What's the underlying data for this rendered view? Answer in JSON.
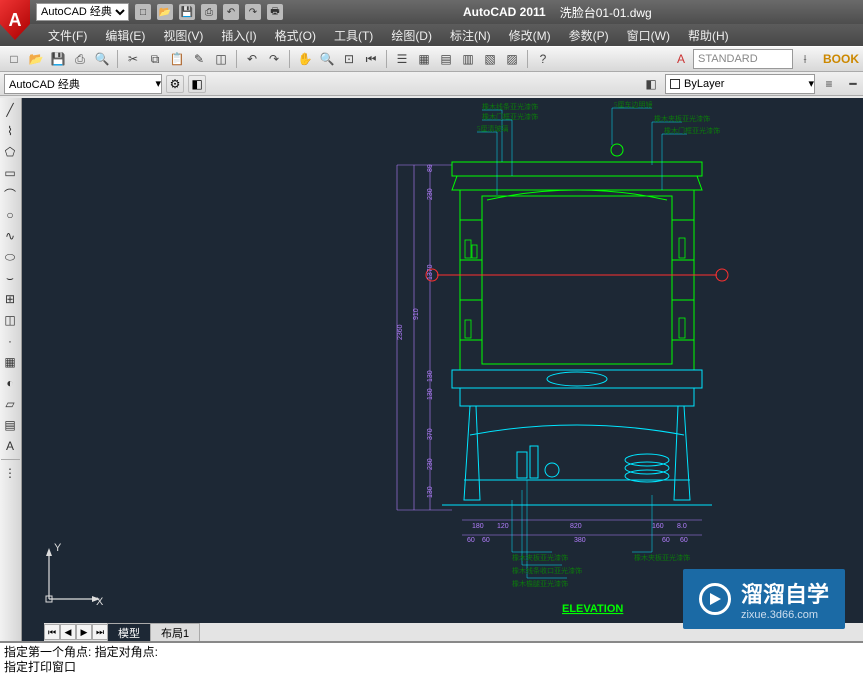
{
  "app": {
    "name": "AutoCAD 2011",
    "document": "洗脸台01-01.dwg",
    "workspace_combo": "AutoCAD 经典",
    "workspace_combo2": "AutoCAD 经典",
    "layer_combo": "ByLayer",
    "style_combo": "STANDARD",
    "book": "BOOK"
  },
  "menus": {
    "file": "文件(F)",
    "edit": "编辑(E)",
    "view": "视图(V)",
    "insert": "插入(I)",
    "format": "格式(O)",
    "tools": "工具(T)",
    "draw": "绘图(D)",
    "dim": "标注(N)",
    "modify": "修改(M)",
    "params": "参数(P)",
    "window": "窗口(W)",
    "help": "帮助(H)"
  },
  "layout_tabs": {
    "model": "模型",
    "layout1": "布局1"
  },
  "cmd": {
    "line1": "指定第一个角点: 指定对角点:",
    "line2": "指定打印窗口"
  },
  "ucs": {
    "y": "Y",
    "x": "X"
  },
  "drawing": {
    "title": "ELEVATION",
    "annotations": {
      "a1": "橡木线条亚光漆饰",
      "a2": "橡木门框亚光漆饰",
      "a3": "5厘清玻璃",
      "a4": "5厘车边明镜",
      "a5": "橡木夹板亚光漆饰",
      "a6": "橡木门框亚光漆饰",
      "a7": "橡木夹板亚光漆饰",
      "a8": "橡木线条收口亚光漆饰",
      "a9": "橡木檐腿亚光漆饰",
      "a10": "橡木夹板亚光漆饰"
    },
    "dims": {
      "d89": "89",
      "d230": "230",
      "d1370": "1370",
      "d910": "910",
      "d2360": "2360",
      "d130a": "130",
      "d130b": "130",
      "d370": "370",
      "d230b": "230",
      "d130c": "130",
      "d180a": "180",
      "d120": "120",
      "d820": "820",
      "d160": "160",
      "d80": "8.0",
      "d60a": "60",
      "d60b": "60",
      "d60c": "60",
      "d60d": "60",
      "d380": "380"
    }
  },
  "watermark": {
    "main": "溜溜自学",
    "sub": "zixue.3d66.com"
  }
}
